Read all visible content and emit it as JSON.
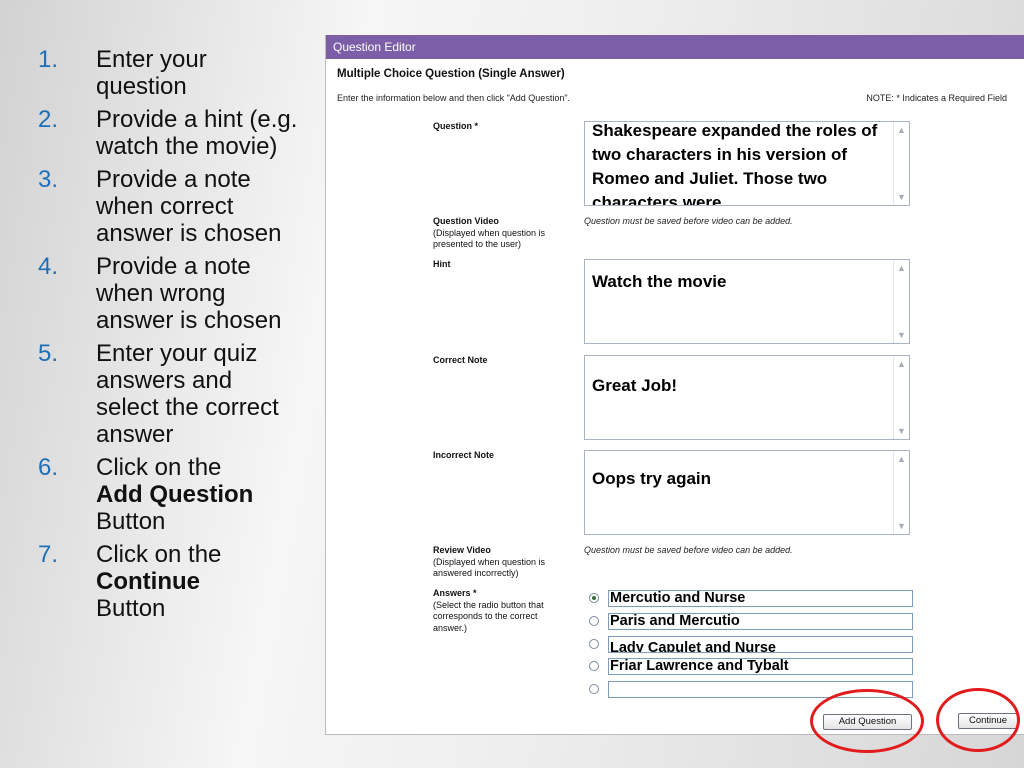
{
  "steps": [
    {
      "num": "1.",
      "text": "Enter your question"
    },
    {
      "num": "2.",
      "text": "Provide a hint (e.g. watch the movie)"
    },
    {
      "num": "3.",
      "text": "Provide a note when correct answer is chosen"
    },
    {
      "num": "4.",
      "text": "Provide a note when wrong answer is chosen"
    },
    {
      "num": "5.",
      "text": "Enter your quiz answers and select the correct answer"
    },
    {
      "num": "6.",
      "pre": "Click on the",
      "bold": "Add Question",
      "post": "Button"
    },
    {
      "num": "7.",
      "pre": "Click on the",
      "bold": "Continue",
      "post": "Button"
    }
  ],
  "editor": {
    "title": "Question Editor",
    "subtitle": "Multiple Choice Question (Single Answer)",
    "instructions": "Enter the information below and then click \"Add Question\".",
    "required_note": "NOTE: * Indicates a Required Field",
    "question": {
      "label": "Question *",
      "value": "Shakespeare expanded the roles of two characters in his version of Romeo and Juliet. Those two characters were _____."
    },
    "question_video": {
      "label": "Question Video",
      "sub": "(Displayed when question is presented to the user)",
      "note": "Question must be saved before video can be added."
    },
    "hint": {
      "label": "Hint",
      "value": "Watch the movie"
    },
    "correct_note": {
      "label": "Correct Note",
      "value": "Great Job!"
    },
    "incorrect_note": {
      "label": "Incorrect Note",
      "value": "Oops try again"
    },
    "review_video": {
      "label": "Review Video",
      "sub": "(Displayed when question is answered incorrectly)",
      "note": "Question must be saved before video can be added."
    },
    "answers": {
      "label": "Answers *",
      "sub": "(Select the radio button that corresponds to the correct answer.)",
      "items": [
        {
          "value": "Mercutio and Nurse",
          "selected": true
        },
        {
          "value": "Paris and Mercutio",
          "selected": false
        },
        {
          "value": "Lady Capulet and Nurse",
          "selected": false
        },
        {
          "value": "Friar Lawrence and Tybalt",
          "selected": false
        },
        {
          "value": "",
          "selected": false
        }
      ]
    },
    "buttons": {
      "add_question": "Add Question",
      "continue": "Continue"
    }
  },
  "colors": {
    "titlebar": "#7b5ea7",
    "highlight_circle": "#e21c1c",
    "list_number": "#1f6fb6"
  }
}
